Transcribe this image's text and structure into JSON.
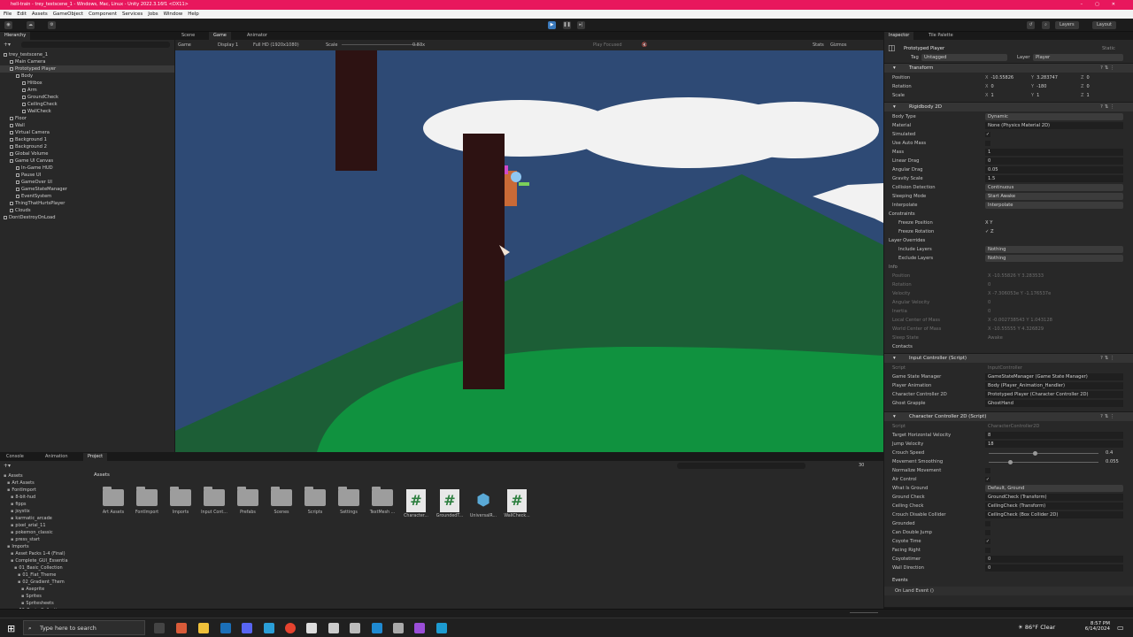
{
  "window": {
    "title": "hell-train - trey_testscene_1 - Windows, Mac, Linux - Unity 2022.3.16f1 <DX11>",
    "controls": [
      "–",
      "▢",
      "✕"
    ]
  },
  "menu": [
    "File",
    "Edit",
    "Assets",
    "GameObject",
    "Component",
    "Services",
    "Jobs",
    "Window",
    "Help"
  ],
  "toolbar": {
    "layers": "Layers",
    "layout": "Layout"
  },
  "hierarchy": {
    "tab": "Hierarchy",
    "items": [
      {
        "label": "trey_testscene_1",
        "depth": 0
      },
      {
        "label": "Main Camera",
        "depth": 1
      },
      {
        "label": "Prototyped Player",
        "depth": 1,
        "selected": true
      },
      {
        "label": "Body",
        "depth": 2
      },
      {
        "label": "Hitbox",
        "depth": 3
      },
      {
        "label": "Arm",
        "depth": 3
      },
      {
        "label": "GroundCheck",
        "depth": 3
      },
      {
        "label": "CeilingCheck",
        "depth": 3
      },
      {
        "label": "WallCheck",
        "depth": 3
      },
      {
        "label": "Floor",
        "depth": 1
      },
      {
        "label": "Wall",
        "depth": 1
      },
      {
        "label": "Virtual Camera",
        "depth": 1
      },
      {
        "label": "Background 1",
        "depth": 1
      },
      {
        "label": "Background 2",
        "depth": 1
      },
      {
        "label": "Global Volume",
        "depth": 1
      },
      {
        "label": "Game UI Canvas",
        "depth": 1
      },
      {
        "label": "In-Game HUD",
        "depth": 2
      },
      {
        "label": "Pause UI",
        "depth": 2
      },
      {
        "label": "GameOver UI",
        "depth": 2
      },
      {
        "label": "GameStateManager",
        "depth": 2
      },
      {
        "label": "EventSystem",
        "depth": 2
      },
      {
        "label": "ThingThatHurtsPlayer",
        "depth": 1
      },
      {
        "label": "Clouds",
        "depth": 1
      },
      {
        "label": "DontDestroyOnLoad",
        "depth": 0
      }
    ]
  },
  "game": {
    "tabs": [
      "Scene",
      "Game",
      "Animator"
    ],
    "active_tab": "Game",
    "display_mode": "Game",
    "display": "Display 1",
    "resolution": "Full HD (1920x1080)",
    "scale_label": "Scale",
    "scale_value": "0.83x",
    "play_focused": "Play Focused",
    "stats": "Stats",
    "gizmos": "Gizmos"
  },
  "inspector": {
    "tabs": [
      "Inspector",
      "Tile Palette"
    ],
    "object_name": "Prototyped Player",
    "static_label": "Static",
    "tag_label": "Tag",
    "tag": "Untagged",
    "layer_label": "Layer",
    "layer": "Player",
    "transform": {
      "title": "Transform",
      "position": {
        "label": "Position",
        "x": "-10.55826",
        "y": "3.283747",
        "z": "0"
      },
      "rotation": {
        "label": "Rotation",
        "x": "0",
        "y": "-180",
        "z": "0"
      },
      "scale": {
        "label": "Scale",
        "x": "1",
        "y": "1",
        "z": "1"
      }
    },
    "rigidbody": {
      "title": "Rigidbody 2D",
      "rows": [
        {
          "label": "Body Type",
          "value": "Dynamic",
          "kind": "dropdown"
        },
        {
          "label": "Material",
          "value": "None (Physics Material 2D)",
          "kind": "box"
        },
        {
          "label": "Simulated",
          "value": "✓",
          "kind": "check"
        },
        {
          "label": "Use Auto Mass",
          "value": "",
          "kind": "check"
        },
        {
          "label": "Mass",
          "value": "1",
          "kind": "box"
        },
        {
          "label": "Linear Drag",
          "value": "0",
          "kind": "box"
        },
        {
          "label": "Angular Drag",
          "value": "0.05",
          "kind": "box"
        },
        {
          "label": "Gravity Scale",
          "value": "1.5",
          "kind": "box"
        },
        {
          "label": "Collision Detection",
          "value": "Continuous",
          "kind": "dropdown"
        },
        {
          "label": "Sleeping Mode",
          "value": "Start Awake",
          "kind": "dropdown"
        },
        {
          "label": "Interpolate",
          "value": "Interpolate",
          "kind": "dropdown"
        }
      ],
      "constraints": "Constraints",
      "freeze_position": "Freeze Position",
      "freeze_rotation": "Freeze Rotation",
      "freeze_pos_value": "X   Y",
      "freeze_rot_value": "✓ Z",
      "layer_overrides": "Layer Overrides",
      "include_layers": {
        "label": "Include Layers",
        "value": "Nothing"
      },
      "exclude_layers": {
        "label": "Exclude Layers",
        "value": "Nothing"
      },
      "info": "Info",
      "info_rows": [
        {
          "label": "Position",
          "value": "X  -10.55826     Y  3.283533"
        },
        {
          "label": "Rotation",
          "value": "0"
        },
        {
          "label": "Velocity",
          "value": "X  -7.306053e     Y  -1.176537e"
        },
        {
          "label": "Angular Velocity",
          "value": "0"
        },
        {
          "label": "Inertia",
          "value": "0"
        },
        {
          "label": "Local Center of Mass",
          "value": "X  -0.002738543     Y  1.043128"
        },
        {
          "label": "World Center of Mass",
          "value": "X  -10.55555     Y  4.326829"
        },
        {
          "label": "Sleep State",
          "value": "Awake"
        }
      ],
      "contacts": "Contacts"
    },
    "input_controller": {
      "title": "Input Controller (Script)",
      "rows": [
        {
          "label": "Script",
          "value": "InputController",
          "kind": "dim"
        },
        {
          "label": "Game State Manager",
          "value": "GameStateManager (Game State Manager)",
          "kind": "box"
        },
        {
          "label": "Player Animation",
          "value": "Body (Player_Animation_Handler)",
          "kind": "box"
        },
        {
          "label": "Character Controller 2D",
          "value": "Prototyped Player (Character Controller 2D)",
          "kind": "box"
        },
        {
          "label": "Ghost Grapple",
          "value": "GhostHand",
          "kind": "box"
        }
      ]
    },
    "character_controller": {
      "title": "Character Controller 2D (Script)",
      "rows": [
        {
          "label": "Script",
          "value": "CharacterController2D",
          "kind": "dim"
        },
        {
          "label": "Target Horizontal Velocity",
          "value": "8",
          "kind": "box"
        },
        {
          "label": "Jump Velocity",
          "value": "18",
          "kind": "box"
        },
        {
          "label": "Crouch Speed",
          "value": "0.4",
          "kind": "slider",
          "fraction": 0.4
        },
        {
          "label": "Movement Smoothing",
          "value": "0.055",
          "kind": "slider",
          "fraction": 0.18
        },
        {
          "label": "Normalize Movement",
          "value": "",
          "kind": "check"
        },
        {
          "label": "Air Control",
          "value": "✓",
          "kind": "check"
        },
        {
          "label": "What Is Ground",
          "value": "Default, Ground",
          "kind": "dropdown"
        },
        {
          "label": "Ground Check",
          "value": "GroundCheck (Transform)",
          "kind": "box"
        },
        {
          "label": "Ceiling Check",
          "value": "CeilingCheck (Transform)",
          "kind": "box"
        },
        {
          "label": "Crouch Disable Collider",
          "value": "CeilingCheck (Box Collider 2D)",
          "kind": "box"
        },
        {
          "label": "Grounded",
          "value": "",
          "kind": "check"
        },
        {
          "label": "Can Double Jump",
          "value": "",
          "kind": "check"
        },
        {
          "label": "Coyote Time",
          "value": "✓",
          "kind": "check"
        },
        {
          "label": "Facing Right",
          "value": "",
          "kind": "check"
        },
        {
          "label": "Coyotetimer",
          "value": "0",
          "kind": "box"
        },
        {
          "label": "Wall Direction",
          "value": "0",
          "kind": "box"
        }
      ],
      "events": "Events",
      "on_land": "On Land Event ()"
    }
  },
  "project": {
    "tabs": [
      "Console",
      "Animation",
      "Project"
    ],
    "active_tab": "Project",
    "tree": [
      "Assets",
      "Art Assets",
      "FontImport",
      "8-bit-hud",
      "fipps",
      "joystix",
      "karmatic_arcade",
      "pixel_arial_11",
      "pokemon_classic",
      "press_start",
      "Imports",
      "Asset Packs 1-4 (Final)",
      "Complete_GUI_Essentia",
      "01_Basic_Collection",
      "01_Flat_Theme",
      "02_Gradient_Them",
      "Aseprite",
      "Sprites",
      "Spritesheets",
      "02_Basic_Collection"
    ],
    "breadcrumb": "Assets",
    "assets": [
      {
        "label": "Art Assets",
        "kind": "folder"
      },
      {
        "label": "FontImport",
        "kind": "folder"
      },
      {
        "label": "Imports",
        "kind": "folder"
      },
      {
        "label": "Input Cont...",
        "kind": "folder"
      },
      {
        "label": "Prefabs",
        "kind": "folder"
      },
      {
        "label": "Scenes",
        "kind": "folder"
      },
      {
        "label": "Scripts",
        "kind": "folder"
      },
      {
        "label": "Settings",
        "kind": "folder"
      },
      {
        "label": "TextMesh ...",
        "kind": "folder"
      },
      {
        "label": "Character...",
        "kind": "script"
      },
      {
        "label": "GroundedT...",
        "kind": "script"
      },
      {
        "label": "UniversalR...",
        "kind": "asset"
      },
      {
        "label": "WallCheck...",
        "kind": "script"
      }
    ],
    "count": "30"
  },
  "taskbar": {
    "search": "Type here to search",
    "weather": "86°F  Clear",
    "time": "8:57 PM",
    "date": "6/14/2024"
  }
}
